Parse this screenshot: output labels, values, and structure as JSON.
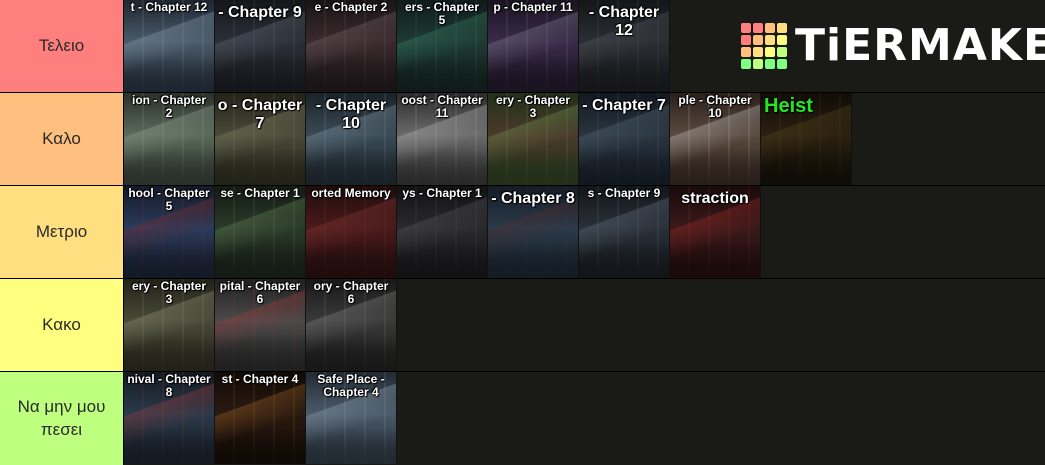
{
  "logo": {
    "text": "TiERMAKER",
    "grid_colors": [
      "#ff7f7f",
      "#ff7f7f",
      "#ffbf7f",
      "#ffdf7f",
      "#ff7f7f",
      "#ffbf7f",
      "#ffdf7f",
      "#ffff7f",
      "#ffbf7f",
      "#ffdf7f",
      "#ffff7f",
      "#bfff7f",
      "#7fff7f",
      "#bfff7f",
      "#7fff7f",
      "#7fff7f"
    ]
  },
  "tiers": [
    {
      "label": "Τελειο",
      "color": "#ff7f7f",
      "items": [
        {
          "caption": "t - Chapter 12",
          "palette": [
            "#4a5a6a",
            "#1e2630",
            "#8fa6b8"
          ]
        },
        {
          "caption": "- Chapter 9",
          "palette": [
            "#2b2f38",
            "#15161a",
            "#6a7480"
          ],
          "big": true
        },
        {
          "caption": "e - Chapter 2",
          "palette": [
            "#3a2a2e",
            "#1a1416",
            "#7a6a70"
          ]
        },
        {
          "caption": "ers - Chapter\n5",
          "palette": [
            "#1f3a34",
            "#0f1c19",
            "#3c8a6a"
          ]
        },
        {
          "caption": "p - Chapter 11",
          "palette": [
            "#3a2a4a",
            "#1a1320",
            "#8a8a9a"
          ]
        },
        {
          "caption": "- Chapter 12",
          "palette": [
            "#2a2e33",
            "#141619",
            "#5a6068"
          ],
          "big": true
        }
      ]
    },
    {
      "label": "Καλο",
      "color": "#ffbf7f",
      "items": [
        {
          "caption": "ion - Chapter\n2",
          "palette": [
            "#5a6a5a",
            "#2a302a",
            "#9aaa9a"
          ]
        },
        {
          "caption": "o - Chapter 7",
          "palette": [
            "#4a4a3a",
            "#222218",
            "#8a8a6a"
          ],
          "big": true
        },
        {
          "caption": "- Chapter 10",
          "palette": [
            "#3a4a55",
            "#1a2228",
            "#8aa0b0"
          ],
          "big": true
        },
        {
          "caption": "oost - Chapter\n11",
          "palette": [
            "#6a6a6a",
            "#2a2a2a",
            "#bcbcbc"
          ]
        },
        {
          "caption": "ery - Chapter\n3",
          "palette": [
            "#4a3a2a",
            "#22301a",
            "#7a9a5a"
          ]
        },
        {
          "caption": "- Chapter 7",
          "palette": [
            "#2a3540",
            "#121820",
            "#5a7080"
          ],
          "big": true
        },
        {
          "caption": "ple - Chapter\n10",
          "palette": [
            "#5a4a40",
            "#2a201a",
            "#d0d0d0"
          ]
        },
        {
          "caption": "Heist",
          "palette": [
            "#2a2010",
            "#100c06",
            "#5a4a20"
          ],
          "big": true,
          "green": true
        }
      ]
    },
    {
      "label": "Μετριο",
      "color": "#ffdf7f",
      "items": [
        {
          "caption": "hool - Chapter\n5",
          "palette": [
            "#2a3a5a",
            "#141a28",
            "#8a2a2a"
          ]
        },
        {
          "caption": "se - Chapter 1",
          "palette": [
            "#2a3a2a",
            "#141a14",
            "#6a8a5a"
          ]
        },
        {
          "caption": "orted Memory",
          "palette": [
            "#4a1a1a",
            "#200c0c",
            "#8a3a3a"
          ]
        },
        {
          "caption": "ys - Chapter 1",
          "palette": [
            "#2a2a2e",
            "#121214",
            "#5a5a60"
          ]
        },
        {
          "caption": "- Chapter 8",
          "palette": [
            "#2a3a4a",
            "#141c24",
            "#5a2a2a"
          ],
          "big": true
        },
        {
          "caption": "s - Chapter 9",
          "palette": [
            "#2a3038",
            "#12161a",
            "#6a7a8a"
          ]
        },
        {
          "caption": "straction",
          "palette": [
            "#3a1a1a",
            "#1a0a0a",
            "#aa2a2a"
          ],
          "big": true
        }
      ]
    },
    {
      "label": "Κακο",
      "color": "#ffff7f",
      "items": [
        {
          "caption": "ery - Chapter\n3",
          "palette": [
            "#4a4a3a",
            "#222218",
            "#9a9a7a"
          ]
        },
        {
          "caption": "pital - Chapter\n6",
          "palette": [
            "#4a4a4a",
            "#202020",
            "#aa3a3a"
          ]
        },
        {
          "caption": "ory - Chapter\n6",
          "palette": [
            "#3a3a3a",
            "#181818",
            "#8a8a8a"
          ]
        }
      ]
    },
    {
      "label": "Να μην μου\nπεσει",
      "color": "#bfff7f",
      "items": [
        {
          "caption": "nival - Chapter\n8",
          "palette": [
            "#2a3a4a",
            "#141a22",
            "#aa3a3a"
          ]
        },
        {
          "caption": "st - Chapter 4",
          "palette": [
            "#2a1a10",
            "#100a06",
            "#aa6a2a"
          ]
        },
        {
          "caption": "Safe Place -\nChapter 4",
          "palette": [
            "#4a5a6a",
            "#222a32",
            "#9aaaba"
          ]
        }
      ]
    }
  ]
}
